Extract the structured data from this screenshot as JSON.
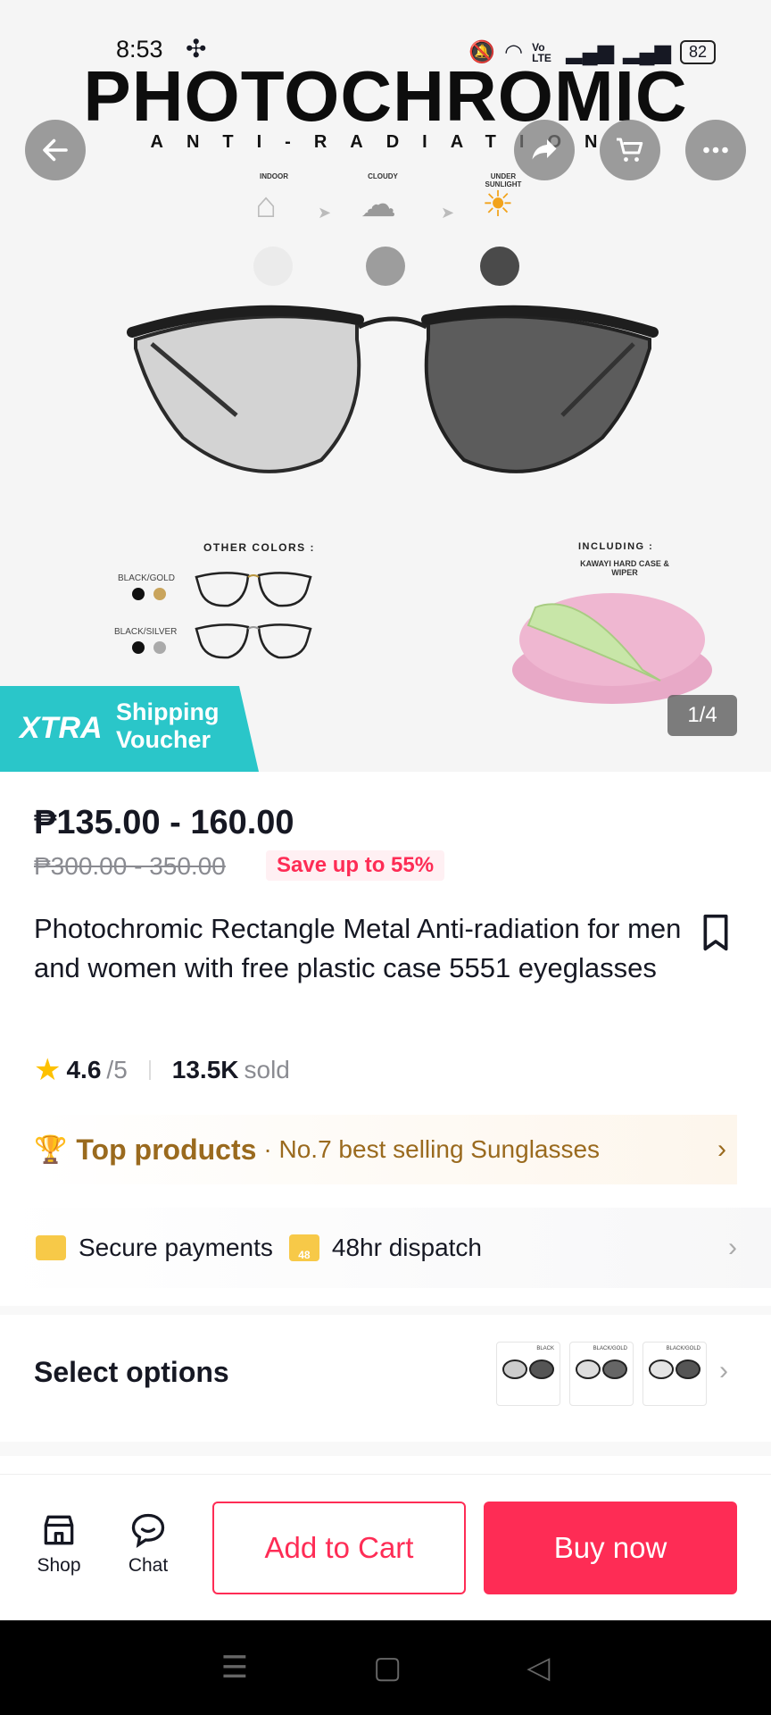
{
  "status_bar": {
    "time": "8:53",
    "battery": "82",
    "network": "Vo LTE"
  },
  "hero": {
    "title": "PHOTOCHROMIC",
    "subtitle": "ANTI-RADIATION",
    "conditions": [
      {
        "label": "INDOOR",
        "icon": "house-icon"
      },
      {
        "label": "CLOUDY",
        "icon": "cloud-icon"
      },
      {
        "label": "UNDER SUNLIGHT",
        "icon": "sun-icon"
      }
    ],
    "other_colors_title": "OTHER COLORS :",
    "color_options": [
      "BLACK/GOLD",
      "BLACK/SILVER"
    ],
    "including_title": "INCLUDING :",
    "including_sub": "KAWAYI HARD CASE & WIPER",
    "image_counter": "1/4",
    "voucher": {
      "brand": "XTRA",
      "line1": "Shipping",
      "line2": "Voucher"
    }
  },
  "product": {
    "price": "₱135.00 - 160.00",
    "original_price": "₱300.00 - 350.00",
    "save_badge": "Save up to 55%",
    "title": "Photochromic Rectangle Metal Anti-radiation for men and women with free plastic case 5551 eyeglasses",
    "rating": "4.6",
    "rating_max": "/5",
    "sold_count": "13.5K",
    "sold_label": "sold"
  },
  "top_products": {
    "label": "Top products",
    "detail": "· No.7 best selling Sunglasses"
  },
  "services": {
    "secure": "Secure payments",
    "dispatch": "48hr dispatch",
    "dispatch_icon_text": "48"
  },
  "options": {
    "label": "Select options",
    "thumb_labels": [
      "BLACK",
      "BLACK/GOLD",
      "BLACK/GOLD"
    ]
  },
  "bottom_bar": {
    "shop": "Shop",
    "chat": "Chat",
    "add_to_cart": "Add to Cart",
    "buy_now": "Buy now"
  },
  "colors": {
    "accent": "#fe2c55",
    "voucher": "#2ac6c9",
    "gold": "#9a6a1e"
  }
}
